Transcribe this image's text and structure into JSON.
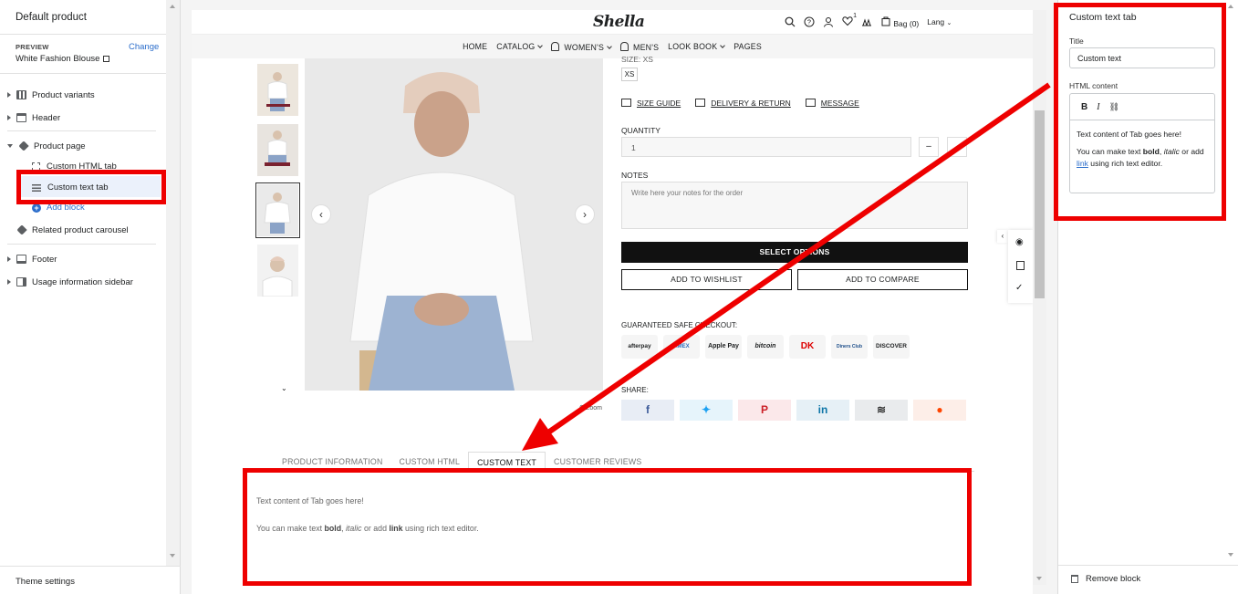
{
  "sidebar": {
    "title": "Default product",
    "preview_label": "PREVIEW",
    "change_label": "Change",
    "product_name": "White Fashion Blouse",
    "items": [
      {
        "label": "Product variants"
      },
      {
        "label": "Header"
      },
      {
        "label": "Product page"
      },
      {
        "label": "Related product carousel"
      },
      {
        "label": "Footer"
      },
      {
        "label": "Usage information sidebar"
      }
    ],
    "sub_items": [
      {
        "label": "Custom HTML tab"
      },
      {
        "label": "Custom text tab"
      }
    ],
    "add_block": "Add block",
    "theme_settings": "Theme settings"
  },
  "store": {
    "logo": "Shella",
    "bag": "Bag (0)",
    "lang": "Lang",
    "wishlist_count": "1",
    "nav": [
      "HOME",
      "CATALOG",
      "WOMEN'S",
      "MEN'S",
      "LOOK BOOK",
      "PAGES"
    ],
    "size_label": "SIZE: XS",
    "size_value": "XS",
    "links": [
      "SIZE GUIDE",
      "DELIVERY & RETURN",
      "MESSAGE"
    ],
    "quantity_label": "QUANTITY",
    "quantity_value": "1",
    "qty_minus": "–",
    "notes_label": "NOTES",
    "notes_placeholder": "Write here your notes for the order",
    "select_options": "SELECT OPTIONS",
    "add_wishlist": "ADD TO WISHLIST",
    "add_compare": "ADD TO COMPARE",
    "guaranteed": "GUARANTEED SAFE CHECKOUT:",
    "payments": [
      "afterpay",
      "AMEX",
      "Apple Pay",
      "bitcoin",
      "DK",
      "Diners Club",
      "DISCOVER"
    ],
    "share_label": "SHARE:",
    "zoom": "Zoom",
    "tabs": [
      "PRODUCT INFORMATION",
      "CUSTOM HTML",
      "CUSTOM TEXT",
      "CUSTOMER REVIEWS"
    ],
    "tab_text_1": "Text content of Tab goes here!",
    "tab_text_2a": "You can make text ",
    "tab_text_2b": "bold",
    "tab_text_2c": ", ",
    "tab_text_2d": "italic",
    "tab_text_2e": " or add ",
    "tab_text_2f": "link",
    "tab_text_2g": " using rich text editor."
  },
  "panel": {
    "title": "Custom text tab",
    "title_label": "Title",
    "title_value": "Custom text",
    "html_label": "HTML content",
    "rte_p1": "Text content of Tab goes here!",
    "rte_p2a": "You can make text ",
    "rte_p2b": "bold",
    "rte_p2c": ", ",
    "rte_p2d": "italic",
    "rte_p2e": " or add ",
    "rte_p2f": "link",
    "rte_p2g": " using rich text editor.",
    "remove_block": "Remove block"
  },
  "colors": {
    "annotation": "#ee0000",
    "accent": "#2c6ecb"
  }
}
